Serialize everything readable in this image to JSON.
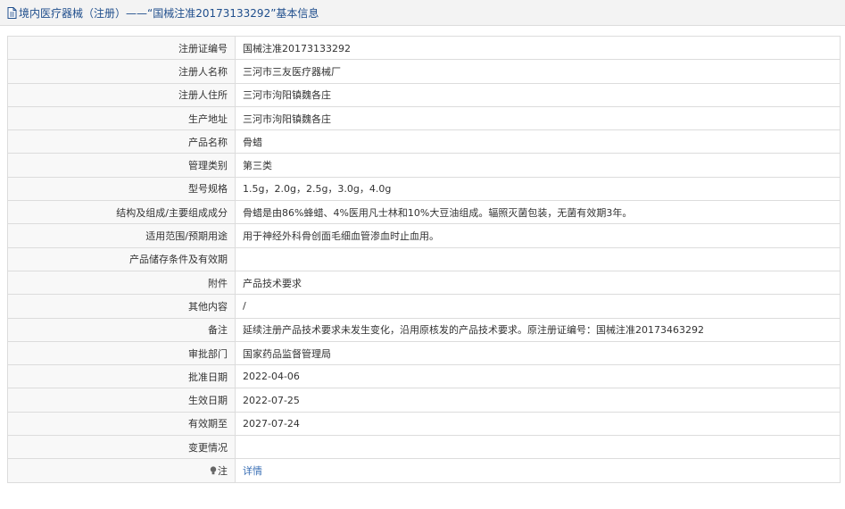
{
  "page": {
    "title": "境内医疗器械（注册）——“国械注准20173133292”基本信息"
  },
  "rows": [
    {
      "label": "注册证编号",
      "value": "国械注准20173133292"
    },
    {
      "label": "注册人名称",
      "value": "三河市三友医疗器械厂"
    },
    {
      "label": "注册人住所",
      "value": "三河市泃阳镇魏各庄"
    },
    {
      "label": "生产地址",
      "value": "三河市泃阳镇魏各庄"
    },
    {
      "label": "产品名称",
      "value": "骨蜡"
    },
    {
      "label": "管理类别",
      "value": "第三类"
    },
    {
      "label": "型号规格",
      "value": "1.5g，2.0g，2.5g，3.0g，4.0g"
    },
    {
      "label": "结构及组成/主要组成成分",
      "value": "骨蜡是由86%蜂蜡、4%医用凡士林和10%大豆油组成。辐照灭菌包装，无菌有效期3年。"
    },
    {
      "label": "适用范围/预期用途",
      "value": "用于神经外科骨创面毛细血管渗血时止血用。"
    },
    {
      "label": "产品储存条件及有效期",
      "value": ""
    },
    {
      "label": "附件",
      "value": "产品技术要求"
    },
    {
      "label": "其他内容",
      "value": "/"
    },
    {
      "label": "备注",
      "value": "延续注册产品技术要求未发生变化，沿用原核发的产品技术要求。原注册证编号：国械注准20173463292"
    },
    {
      "label": "审批部门",
      "value": "国家药品监督管理局"
    },
    {
      "label": "批准日期",
      "value": "2022-04-06"
    },
    {
      "label": "生效日期",
      "value": "2022-07-25"
    },
    {
      "label": "有效期至",
      "value": "2027-07-24"
    },
    {
      "label": "变更情况",
      "value": ""
    }
  ],
  "note": {
    "label": "注",
    "icon": "lightbulb-icon",
    "link": "详情"
  },
  "colors": {
    "title_text": "#1f4e8c",
    "link": "#3a6fb5",
    "border": "#dcdcdc"
  }
}
